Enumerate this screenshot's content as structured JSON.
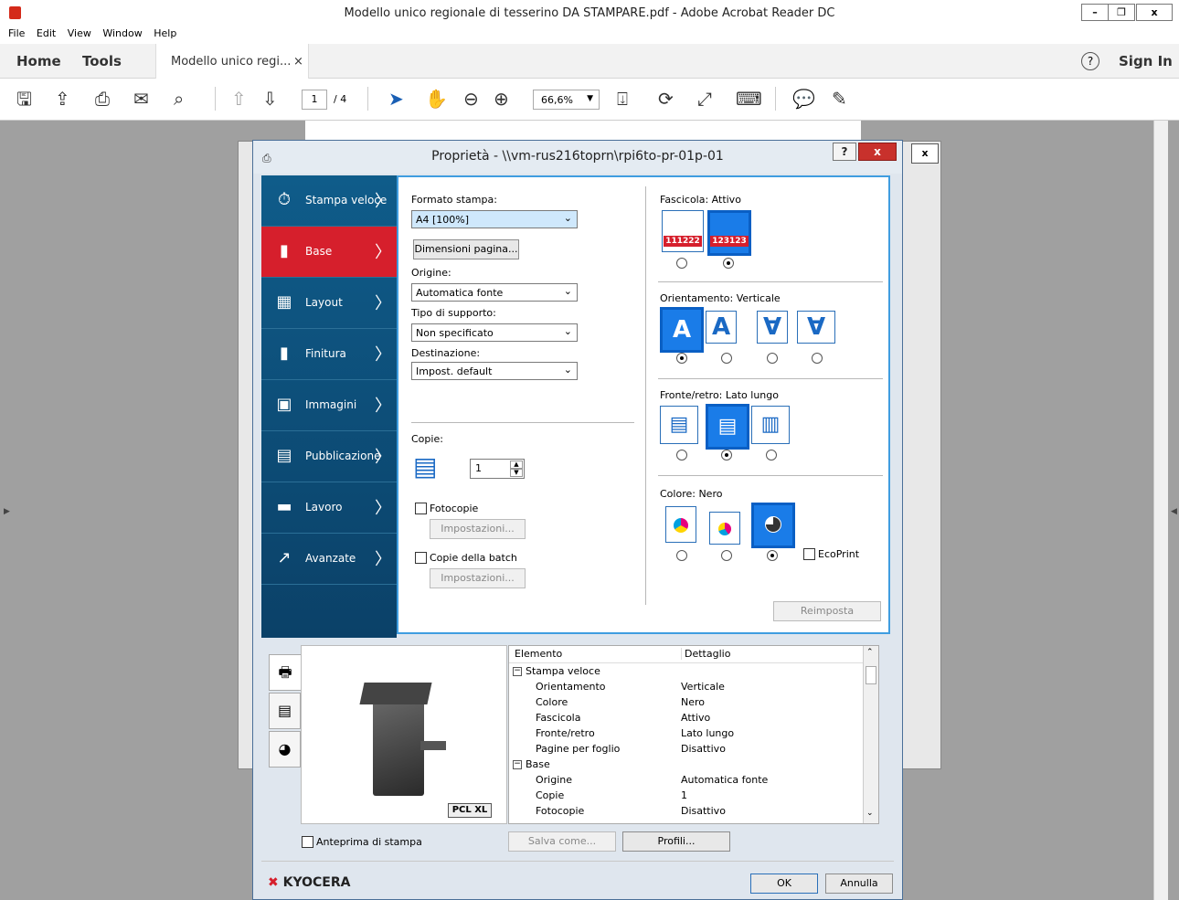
{
  "window": {
    "title": "Modello unico regionale di tesserino DA STAMPARE.pdf - Adobe Acrobat Reader DC"
  },
  "menu": [
    "File",
    "Edit",
    "View",
    "Window",
    "Help"
  ],
  "tabs": {
    "home": "Home",
    "tools": "Tools",
    "doc": "Modello unico regi...",
    "close": "×"
  },
  "account": {
    "help": "?",
    "sign_in": "Sign In"
  },
  "toolbar": {
    "page_current": "1",
    "page_total": "/ 4",
    "zoom": "66,6%"
  },
  "dialog": {
    "title": "Proprietà - \\\\vm-rus216toprn\\rpi6to-pr-01p-01",
    "help_btn": "?",
    "close_btn": "x",
    "sidebar": [
      {
        "label": "Stampa veloce",
        "icon": "⏱"
      },
      {
        "label": "Base",
        "icon": "▮"
      },
      {
        "label": "Layout",
        "icon": "▦"
      },
      {
        "label": "Finitura",
        "icon": "▮"
      },
      {
        "label": "Immagini",
        "icon": "▣"
      },
      {
        "label": "Pubblicazione",
        "icon": "▤"
      },
      {
        "label": "Lavoro",
        "icon": "▬"
      },
      {
        "label": "Avanzate",
        "icon": "↗"
      }
    ],
    "formato_label": "Formato stampa:",
    "formato_value": "A4  [100%]",
    "dim_button": "Dimensioni pagina...",
    "origine_label": "Origine:",
    "origine_value": "Automatica fonte",
    "tipo_label": "Tipo di supporto:",
    "tipo_value": "Non specificato",
    "dest_label": "Destinazione:",
    "dest_value": "Impost. default",
    "copie_label": "Copie:",
    "copie_value": "1",
    "fotocopie_label": "Fotocopie",
    "impostazioni1": "Impostazioni...",
    "batch_label": "Copie della batch",
    "impostazioni2": "Impostazioni...",
    "fascicola_label": "Fascicola:  Attivo",
    "fascicola_icon_a": "111222",
    "fascicola_icon_b": "123123",
    "orient_label": "Orientamento:  Verticale",
    "orient_glyph": "A",
    "orient_glyph_inverted": "∀",
    "fronte_label": "Fronte/retro:  Lato lungo",
    "colore_label": "Colore:  Nero",
    "ecoprint_label": "EcoPrint",
    "reimposta": "Reimposta",
    "pcl_badge": "PCL XL",
    "list_headers": [
      "Elemento",
      "Dettaglio"
    ],
    "list_rows": [
      {
        "k": "Stampa veloce",
        "v": "",
        "group": true
      },
      {
        "k": "Orientamento",
        "v": "Verticale",
        "group": false
      },
      {
        "k": "Colore",
        "v": "Nero",
        "group": false
      },
      {
        "k": "Fascicola",
        "v": "Attivo",
        "group": false
      },
      {
        "k": "Fronte/retro",
        "v": "Lato lungo",
        "group": false
      },
      {
        "k": "Pagine per foglio",
        "v": "Disattivo",
        "group": false
      },
      {
        "k": "Base",
        "v": "",
        "group": true
      },
      {
        "k": "Origine",
        "v": "Automatica fonte",
        "group": false
      },
      {
        "k": "Copie",
        "v": "1",
        "group": false
      },
      {
        "k": "Fotocopie",
        "v": "Disattivo",
        "group": false
      }
    ],
    "anteprima_label": "Anteprima di stampa",
    "salva_come": "Salva come...",
    "profili": "Profili...",
    "brand": "KYOCERA",
    "ok": "OK",
    "annulla": "Annulla"
  }
}
